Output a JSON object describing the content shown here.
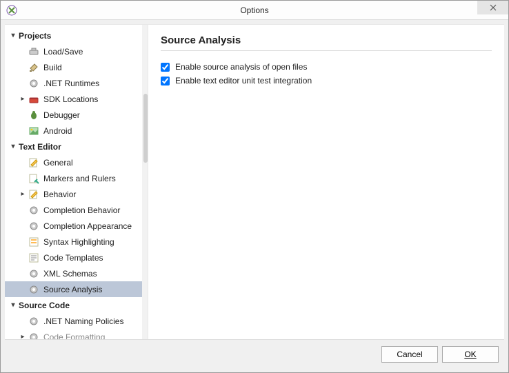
{
  "window": {
    "title": "Options"
  },
  "sidebar": {
    "categories": [
      {
        "label": "Projects",
        "expanded": true,
        "items": [
          {
            "label": "Load/Save",
            "icon": "loadsave-icon"
          },
          {
            "label": "Build",
            "icon": "build-icon"
          },
          {
            "label": ".NET Runtimes",
            "icon": "gear-icon"
          },
          {
            "label": "SDK Locations",
            "icon": "toolbox-icon",
            "expandable": true
          },
          {
            "label": "Debugger",
            "icon": "bug-icon"
          },
          {
            "label": "Android",
            "icon": "image-icon"
          }
        ]
      },
      {
        "label": "Text Editor",
        "expanded": true,
        "items": [
          {
            "label": "General",
            "icon": "edit-icon"
          },
          {
            "label": "Markers and Rulers",
            "icon": "markers-icon"
          },
          {
            "label": "Behavior",
            "icon": "edit-icon",
            "expandable": true
          },
          {
            "label": "Completion Behavior",
            "icon": "gear-icon"
          },
          {
            "label": "Completion Appearance",
            "icon": "gear-icon"
          },
          {
            "label": "Syntax Highlighting",
            "icon": "highlight-icon"
          },
          {
            "label": "Code Templates",
            "icon": "templates-icon"
          },
          {
            "label": "XML Schemas",
            "icon": "gear-icon"
          },
          {
            "label": "Source Analysis",
            "icon": "gear-icon",
            "selected": true
          }
        ]
      },
      {
        "label": "Source Code",
        "expanded": true,
        "items": [
          {
            "label": ".NET Naming Policies",
            "icon": "gear-icon"
          },
          {
            "label": "Code Formatting",
            "icon": "gear-icon",
            "expandable": true,
            "cutoff": true
          }
        ]
      }
    ]
  },
  "content": {
    "heading": "Source Analysis",
    "options": [
      {
        "label": "Enable source analysis of open files",
        "checked": true
      },
      {
        "label": "Enable text editor unit test integration",
        "checked": true
      }
    ]
  },
  "footer": {
    "cancel": "Cancel",
    "ok": "OK"
  }
}
